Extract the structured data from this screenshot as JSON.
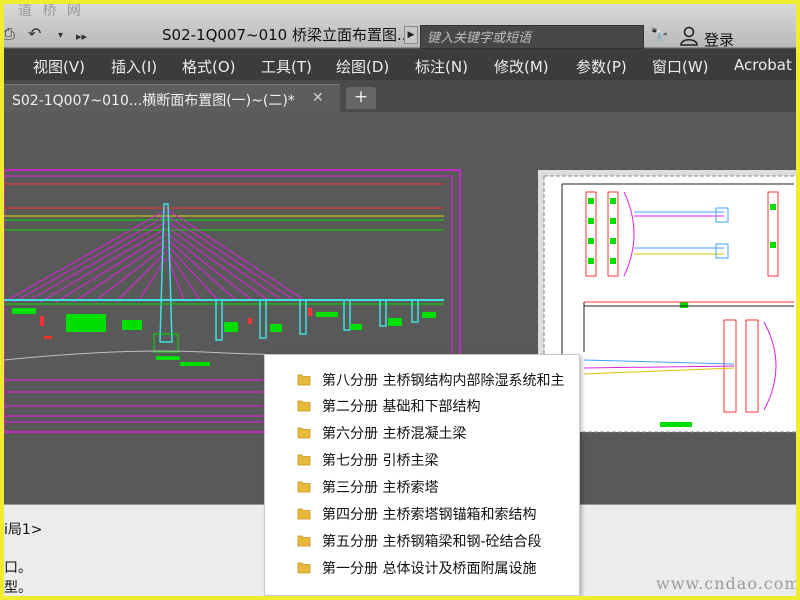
{
  "watermark_top": "道 桥 网",
  "toolbar": {
    "title": "S02-1Q007~010 桥梁立面布置图...",
    "search_placeholder": "键入关键字或短语",
    "login": "登录"
  },
  "menu": [
    "视图(V)",
    "插入(I)",
    "格式(O)",
    "工具(T)",
    "绘图(D)",
    "标注(N)",
    "修改(M)",
    "参数(P)",
    "窗口(W)",
    "Acrobat"
  ],
  "tab": {
    "label": "S02-1Q007~010...横断面布置图(一)~(二)*",
    "close": "✕",
    "new": "+"
  },
  "command": [
    "i局1>",
    "口。",
    "型。"
  ],
  "watermark_bottom": "www.cndao.com",
  "folders": [
    "第八分册 主桥钢结构内部除湿系统和主",
    "第二分册 基础和下部结构",
    "第六分册 主桥混凝土梁",
    "第七分册 引桥主梁",
    "第三分册 主桥索塔",
    "第四分册 主桥索塔钢锚箱和索结构",
    "第五分册 主桥钢箱梁和钢-砼结合段",
    "第一分册 总体设计及桥面附属设施"
  ],
  "colors": {
    "highlight_border": "#f2ec2e",
    "folder": "#e8b93a",
    "canvas": "#595959",
    "menubar": "#3c3c3c"
  }
}
